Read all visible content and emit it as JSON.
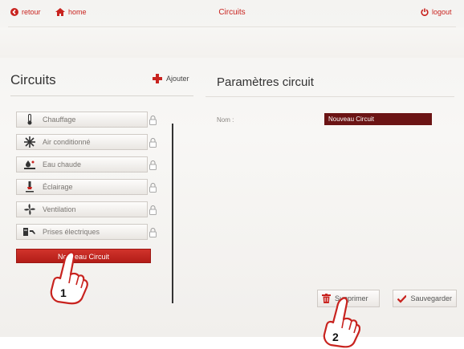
{
  "topbar": {
    "back_label": "retour",
    "home_label": "home",
    "title": "Circuits",
    "logout_label": "logout"
  },
  "left": {
    "title": "Circuits",
    "add_label": "Ajouter",
    "items": [
      {
        "label": "Chauffage",
        "icon": "thermometer-icon"
      },
      {
        "label": "Air conditionné",
        "icon": "snowflake-icon"
      },
      {
        "label": "Eau chaude",
        "icon": "water-heater-icon"
      },
      {
        "label": "Éclairage",
        "icon": "lamp-icon"
      },
      {
        "label": "Ventilation",
        "icon": "fan-icon"
      },
      {
        "label": "Prises électriques",
        "icon": "plug-icon"
      }
    ],
    "new_circuit_label": "Nouveau Circuit"
  },
  "right": {
    "title": "Paramètres circuit",
    "name_label": "Nom :",
    "name_value": "Nouveau Circuit",
    "delete_label": "Supprimer",
    "save_label": "Sauvegarder"
  },
  "callouts": {
    "one": "1",
    "two": "2"
  },
  "colors": {
    "accent": "#c8231f",
    "dark_red": "#6b1414",
    "text": "#333333"
  }
}
